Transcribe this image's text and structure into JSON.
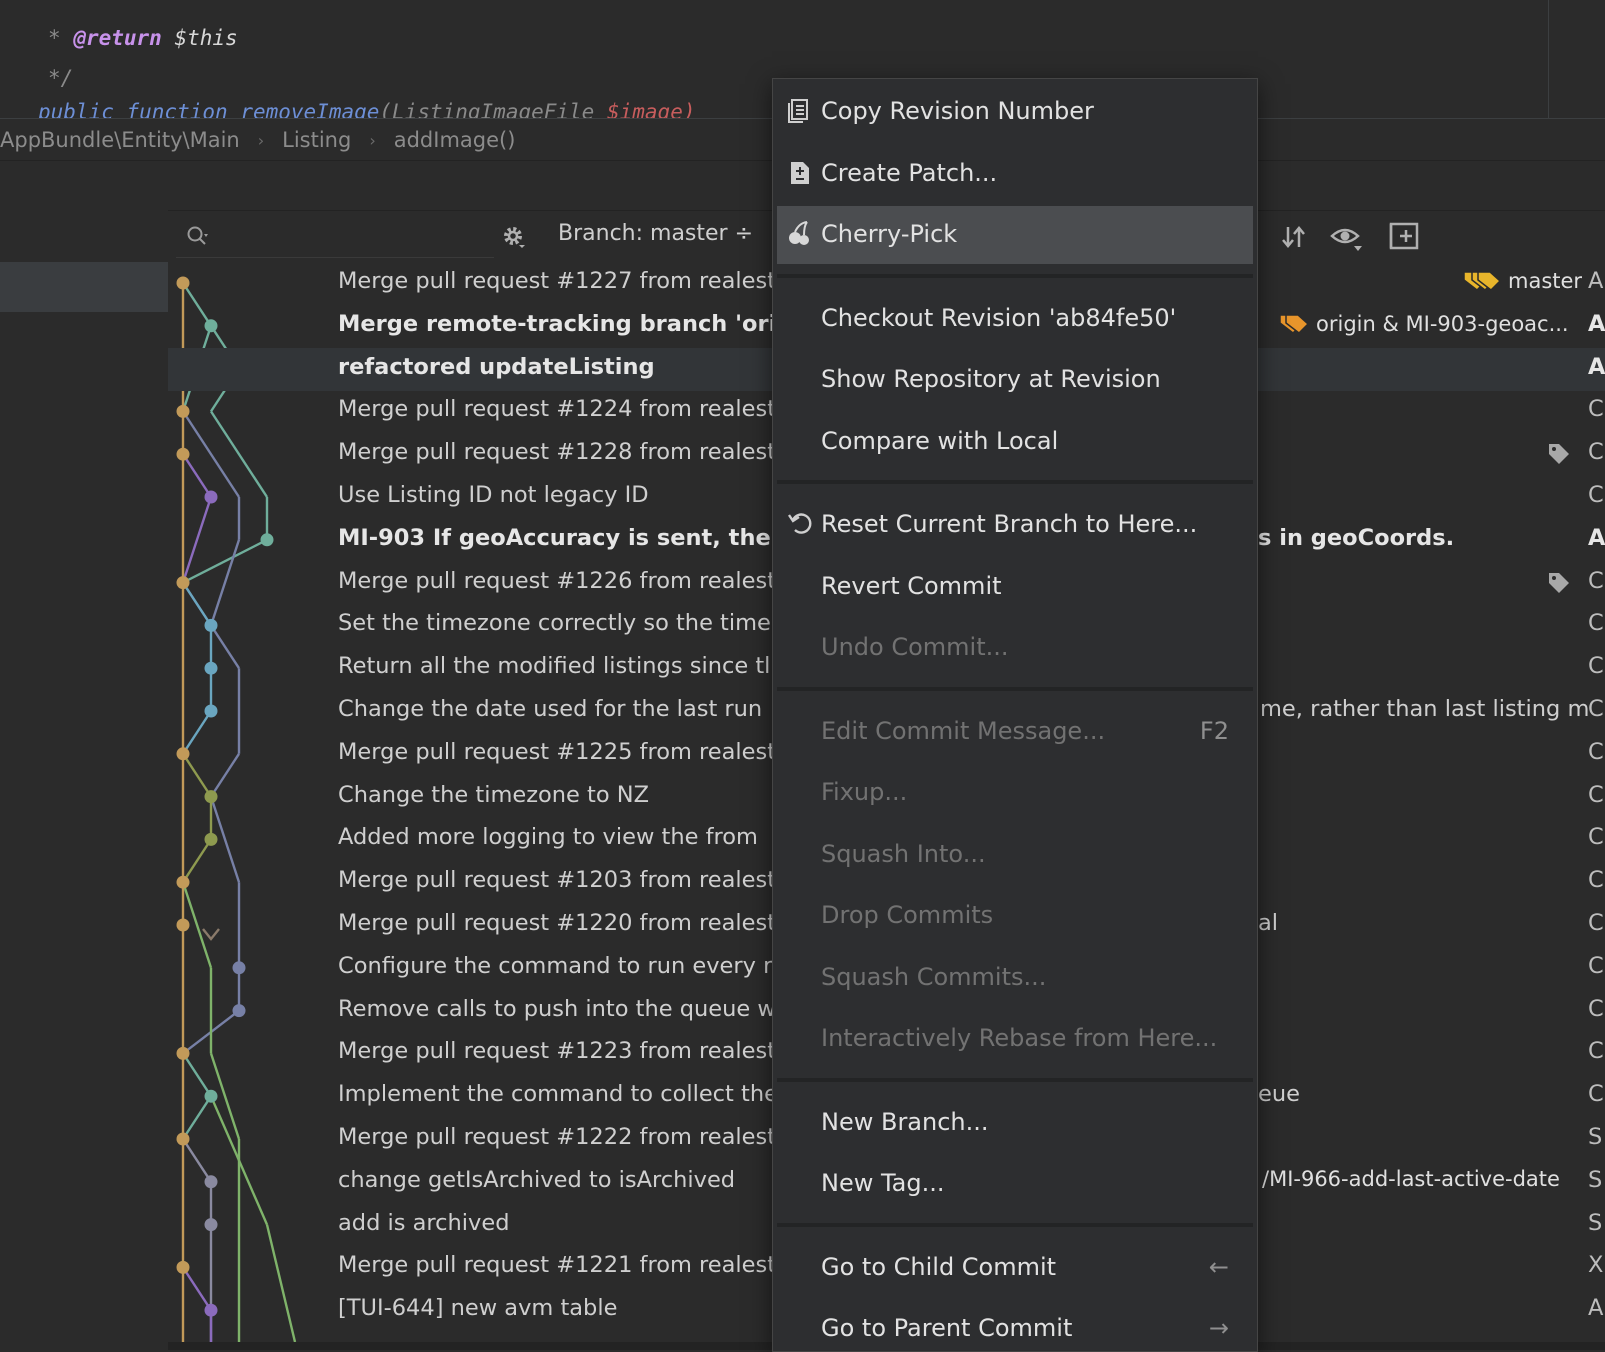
{
  "editor": {
    "line0": "*",
    "line1_star": "*",
    "line1_annot": "@return",
    "line1_rest": "$this",
    "line2": "*/",
    "line3_kw": "public function",
    "line3_fn": "removeImage",
    "line3_args": "(ListingImageFile",
    "line3_var": "$image)"
  },
  "breadcrumb": {
    "items": [
      "AppBundle\\Entity\\Main",
      "Listing",
      "addImage()"
    ],
    "separator": "›"
  },
  "toolbar": {
    "branch_filter": "Branch: master ÷"
  },
  "commits": [
    {
      "message": "Merge pull request #1227 from realest",
      "ref": "master",
      "author": "A"
    },
    {
      "message": "Merge remote-tracking branch 'orig",
      "ref": "origin & MI-903-geoac...",
      "author": "A",
      "bold": true
    },
    {
      "message": "refactored updateListing",
      "author": "A",
      "bold": true
    },
    {
      "message": "Merge pull request #1224 from realest",
      "author": "C"
    },
    {
      "message": "Merge pull request #1228 from realest",
      "author": "C"
    },
    {
      "message": "Use Listing ID not legacy ID",
      "author": "C"
    },
    {
      "message": "MI-903 If geoAccuracy is sent, then",
      "tail": "s in geoCoords.",
      "author": "A",
      "bold": true
    },
    {
      "message": "Merge pull request #1226 from realest",
      "author": "C"
    },
    {
      "message": "Set the timezone correctly so the time",
      "author": "C"
    },
    {
      "message": "Return all the modified listings since tl",
      "author": "C"
    },
    {
      "message": "Change the date used for the last run",
      "tail": "me, rather than last listing m",
      "author": "C"
    },
    {
      "message": "Merge pull request #1225 from realest",
      "author": "C"
    },
    {
      "message": "Change the timezone to NZ",
      "author": "C"
    },
    {
      "message": "Added more logging to view the from",
      "author": "C"
    },
    {
      "message": "Merge pull request #1203 from realest",
      "author": "C"
    },
    {
      "message": "Merge pull request #1220 from realest",
      "tail": "al",
      "author": "C"
    },
    {
      "message": "Configure the command to run every r",
      "author": "C"
    },
    {
      "message": "Remove calls to push into the queue w",
      "author": "C"
    },
    {
      "message": "Merge pull request #1223 from realest",
      "author": "C"
    },
    {
      "message": "Implement the command to collect the",
      "tail": "eue",
      "author": "C"
    },
    {
      "message": "Merge pull request #1222 from realest",
      "author": "S"
    },
    {
      "message": "change getIsArchived to isArchived",
      "ref": "/MI-966-add-last-active-date",
      "author": "S"
    },
    {
      "message": "add is archived",
      "author": "S"
    },
    {
      "message": "Merge pull request #1221 from realesta",
      "author": "X"
    },
    {
      "message": "[TUI-644] new avm table",
      "author": "A"
    }
  ],
  "context_menu": {
    "items": [
      {
        "label": "Copy Revision Number",
        "icon": "copy-icon"
      },
      {
        "label": "Create Patch...",
        "icon": "patch-icon"
      },
      {
        "label": "Cherry-Pick",
        "icon": "cherry-pick-icon",
        "active": true
      },
      {
        "separator": true
      },
      {
        "label": "Checkout Revision 'ab84fe50'"
      },
      {
        "label": "Show Repository at Revision"
      },
      {
        "label": "Compare with Local"
      },
      {
        "separator": true
      },
      {
        "label": "Reset Current Branch to Here...",
        "icon": "undo-icon"
      },
      {
        "label": "Revert Commit"
      },
      {
        "label": "Undo Commit...",
        "disabled": true
      },
      {
        "separator": true
      },
      {
        "label": "Edit Commit Message...",
        "shortcut": "F2",
        "disabled": true
      },
      {
        "label": "Fixup...",
        "disabled": true
      },
      {
        "label": "Squash Into...",
        "disabled": true
      },
      {
        "label": "Drop Commits",
        "disabled": true
      },
      {
        "label": "Squash Commits...",
        "disabled": true
      },
      {
        "label": "Interactively Rebase from Here...",
        "disabled": true
      },
      {
        "separator": true
      },
      {
        "label": "New Branch..."
      },
      {
        "label": "New Tag..."
      },
      {
        "separator": true
      },
      {
        "label": "Go to Child Commit",
        "shortcut": "←"
      },
      {
        "label": "Go to Parent Commit",
        "shortcut": "→"
      }
    ]
  },
  "colors": {
    "background": "#2b2b2b",
    "menu_bg": "#2d2e30",
    "menu_active": "#4b4d50",
    "tag_yellow": "#e8b52b",
    "tag_orange": "#e8952b",
    "branch_gold": "#c29a59",
    "branch_teal": "#6fae9b",
    "branch_blue": "#6aa6c0",
    "branch_purple": "#8b6bbd",
    "branch_green": "#7fb36a",
    "branch_olive": "#8e9a4f",
    "branch_slate": "#7780a6"
  }
}
